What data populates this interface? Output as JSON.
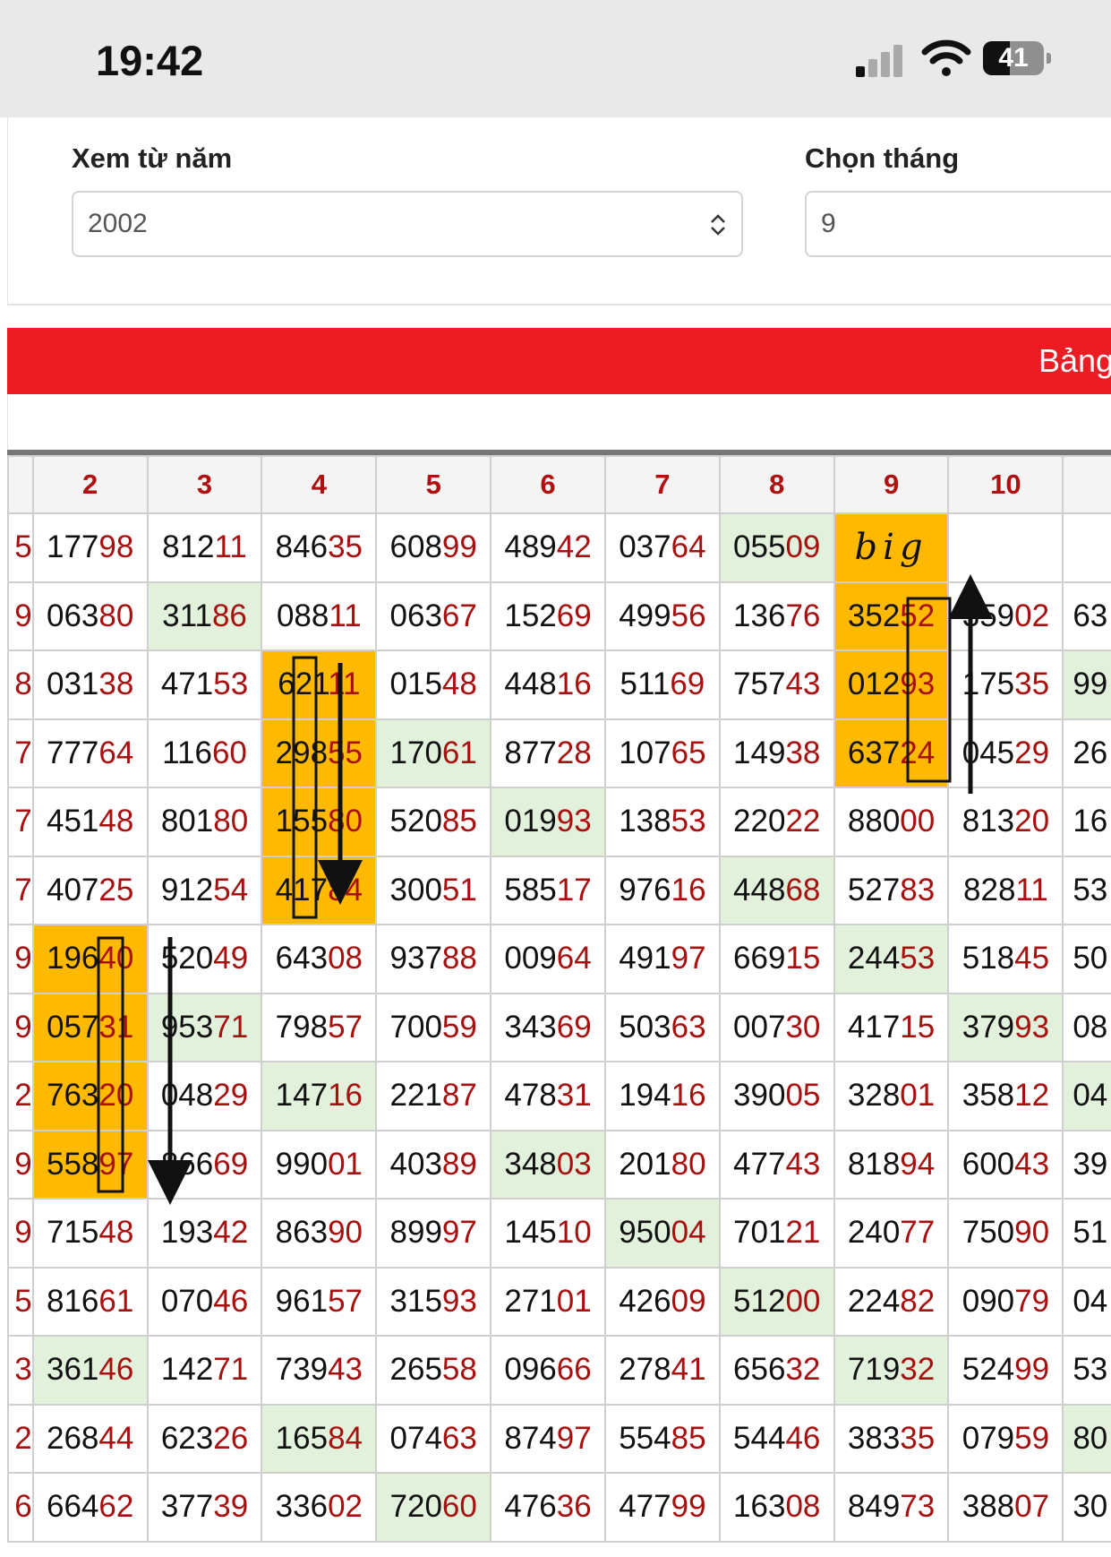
{
  "status_bar": {
    "time": "19:42",
    "battery": "41"
  },
  "filters": {
    "year_label": "Xem từ năm",
    "year_value": "2002",
    "month_label": "Chọn tháng",
    "month_value": "9"
  },
  "banner_title": "Bảng",
  "table": {
    "headers": [
      "",
      "2",
      "3",
      "4",
      "5",
      "6",
      "7",
      "8",
      "9",
      "10",
      ""
    ],
    "annotation_text": "big",
    "rows": [
      {
        "edge": "5",
        "cells": [
          [
            "177",
            "98"
          ],
          [
            "812",
            "11"
          ],
          [
            "846",
            "35"
          ],
          [
            "608",
            "99"
          ],
          [
            "489",
            "42"
          ],
          [
            "037",
            "64"
          ],
          [
            "055",
            "09"
          ],
          [
            "",
            ""
          ],
          [
            "",
            ""
          ]
        ],
        "overflow": ""
      },
      {
        "edge": "9",
        "cells": [
          [
            "063",
            "80"
          ],
          [
            "311",
            "86"
          ],
          [
            "088",
            "11"
          ],
          [
            "063",
            "67"
          ],
          [
            "152",
            "69"
          ],
          [
            "499",
            "56"
          ],
          [
            "136",
            "76"
          ],
          [
            "352",
            "52"
          ],
          [
            "359",
            "02"
          ]
        ],
        "overflow": "63"
      },
      {
        "edge": "8",
        "cells": [
          [
            "031",
            "38"
          ],
          [
            "471",
            "53"
          ],
          [
            "621",
            "11"
          ],
          [
            "015",
            "48"
          ],
          [
            "448",
            "16"
          ],
          [
            "511",
            "69"
          ],
          [
            "757",
            "43"
          ],
          [
            "012",
            "93"
          ],
          [
            "175",
            "35"
          ]
        ],
        "overflow": "99"
      },
      {
        "edge": "7",
        "cells": [
          [
            "777",
            "64"
          ],
          [
            "116",
            "60"
          ],
          [
            "298",
            "55"
          ],
          [
            "170",
            "61"
          ],
          [
            "877",
            "28"
          ],
          [
            "107",
            "65"
          ],
          [
            "149",
            "38"
          ],
          [
            "637",
            "24"
          ],
          [
            "045",
            "29"
          ]
        ],
        "overflow": "26"
      },
      {
        "edge": "7",
        "cells": [
          [
            "451",
            "48"
          ],
          [
            "801",
            "80"
          ],
          [
            "155",
            "80"
          ],
          [
            "520",
            "85"
          ],
          [
            "019",
            "93"
          ],
          [
            "138",
            "53"
          ],
          [
            "220",
            "22"
          ],
          [
            "880",
            "00"
          ],
          [
            "813",
            "20"
          ]
        ],
        "overflow": "16"
      },
      {
        "edge": "7",
        "cells": [
          [
            "407",
            "25"
          ],
          [
            "912",
            "54"
          ],
          [
            "417",
            "84"
          ],
          [
            "300",
            "51"
          ],
          [
            "585",
            "17"
          ],
          [
            "976",
            "16"
          ],
          [
            "448",
            "68"
          ],
          [
            "527",
            "83"
          ],
          [
            "828",
            "11"
          ]
        ],
        "overflow": "53"
      },
      {
        "edge": "9",
        "cells": [
          [
            "196",
            "40"
          ],
          [
            "520",
            "49"
          ],
          [
            "643",
            "08"
          ],
          [
            "937",
            "88"
          ],
          [
            "009",
            "64"
          ],
          [
            "491",
            "97"
          ],
          [
            "669",
            "15"
          ],
          [
            "244",
            "53"
          ],
          [
            "518",
            "45"
          ]
        ],
        "overflow": "50"
      },
      {
        "edge": "9",
        "cells": [
          [
            "057",
            "31"
          ],
          [
            "953",
            "71"
          ],
          [
            "798",
            "57"
          ],
          [
            "700",
            "59"
          ],
          [
            "343",
            "69"
          ],
          [
            "503",
            "63"
          ],
          [
            "007",
            "30"
          ],
          [
            "417",
            "15"
          ],
          [
            "379",
            "93"
          ]
        ],
        "overflow": "08"
      },
      {
        "edge": "2",
        "cells": [
          [
            "763",
            "20"
          ],
          [
            "048",
            "29"
          ],
          [
            "147",
            "16"
          ],
          [
            "221",
            "87"
          ],
          [
            "478",
            "31"
          ],
          [
            "194",
            "16"
          ],
          [
            "390",
            "05"
          ],
          [
            "328",
            "01"
          ],
          [
            "358",
            "12"
          ]
        ],
        "overflow": "04"
      },
      {
        "edge": "9",
        "cells": [
          [
            "558",
            "97"
          ],
          [
            "866",
            "69"
          ],
          [
            "990",
            "01"
          ],
          [
            "403",
            "89"
          ],
          [
            "348",
            "03"
          ],
          [
            "201",
            "80"
          ],
          [
            "477",
            "43"
          ],
          [
            "818",
            "94"
          ],
          [
            "600",
            "43"
          ]
        ],
        "overflow": "39"
      },
      {
        "edge": "9",
        "cells": [
          [
            "715",
            "48"
          ],
          [
            "193",
            "42"
          ],
          [
            "863",
            "90"
          ],
          [
            "899",
            "97"
          ],
          [
            "145",
            "10"
          ],
          [
            "950",
            "04"
          ],
          [
            "701",
            "21"
          ],
          [
            "240",
            "77"
          ],
          [
            "750",
            "90"
          ]
        ],
        "overflow": "51"
      },
      {
        "edge": "5",
        "cells": [
          [
            "816",
            "61"
          ],
          [
            "070",
            "46"
          ],
          [
            "961",
            "57"
          ],
          [
            "315",
            "93"
          ],
          [
            "271",
            "01"
          ],
          [
            "426",
            "09"
          ],
          [
            "512",
            "00"
          ],
          [
            "224",
            "82"
          ],
          [
            "090",
            "79"
          ]
        ],
        "overflow": "04"
      },
      {
        "edge": "3",
        "cells": [
          [
            "361",
            "46"
          ],
          [
            "142",
            "71"
          ],
          [
            "739",
            "43"
          ],
          [
            "265",
            "58"
          ],
          [
            "096",
            "66"
          ],
          [
            "278",
            "41"
          ],
          [
            "656",
            "32"
          ],
          [
            "719",
            "32"
          ],
          [
            "524",
            "99"
          ]
        ],
        "overflow": "53"
      },
      {
        "edge": "2",
        "cells": [
          [
            "268",
            "44"
          ],
          [
            "623",
            "26"
          ],
          [
            "165",
            "84"
          ],
          [
            "074",
            "63"
          ],
          [
            "874",
            "97"
          ],
          [
            "554",
            "85"
          ],
          [
            "544",
            "46"
          ],
          [
            "383",
            "35"
          ],
          [
            "079",
            "59"
          ]
        ],
        "overflow": "80"
      },
      {
        "edge": "6",
        "cells": [
          [
            "664",
            "62"
          ],
          [
            "377",
            "39"
          ],
          [
            "336",
            "02"
          ],
          [
            "720",
            "60"
          ],
          [
            "476",
            "36"
          ],
          [
            "477",
            "99"
          ],
          [
            "163",
            "08"
          ],
          [
            "849",
            "73"
          ],
          [
            "388",
            "07"
          ]
        ],
        "overflow": "30"
      }
    ],
    "colors": {
      "green": "#e2f1dc",
      "orange": "#ffba00",
      "red_banner": "#ec1c24",
      "suffix_red": "#a81010"
    }
  }
}
